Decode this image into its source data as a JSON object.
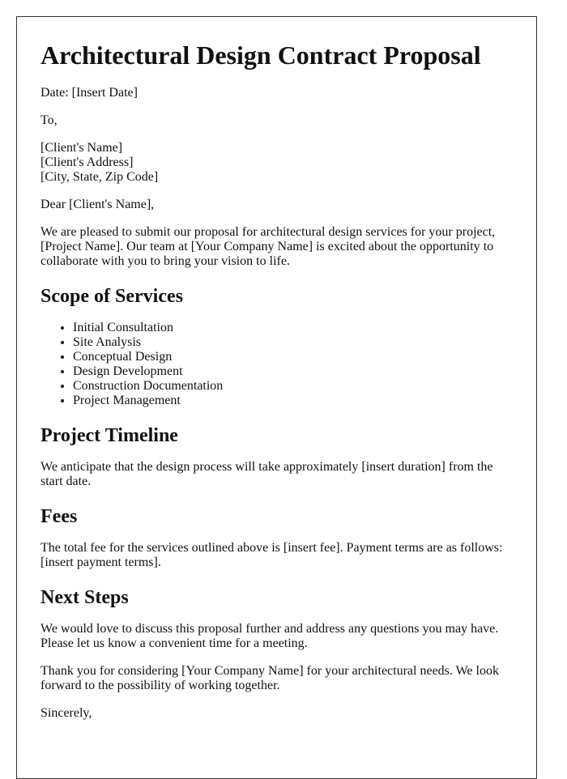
{
  "document": {
    "title": "Architectural Design Contract Proposal",
    "date_line": "Date: [Insert Date]",
    "to_line": "To,",
    "recipient": {
      "name": "[Client's Name]",
      "address": "[Client's Address]",
      "city_state_zip": "[City, State, Zip Code]"
    },
    "salutation": "Dear [Client's Name],",
    "intro": "We are pleased to submit our proposal for architectural design services for your project, [Project Name]. Our team at [Your Company Name] is excited about the opportunity to collaborate with you to bring your vision to life.",
    "sections": {
      "scope": {
        "heading": "Scope of Services",
        "items": [
          "Initial Consultation",
          "Site Analysis",
          "Conceptual Design",
          "Design Development",
          "Construction Documentation",
          "Project Management"
        ]
      },
      "timeline": {
        "heading": "Project Timeline",
        "body": "We anticipate that the design process will take approximately [insert duration] from the start date."
      },
      "fees": {
        "heading": "Fees",
        "body": "The total fee for the services outlined above is [insert fee]. Payment terms are as follows: [insert payment terms]."
      },
      "next_steps": {
        "heading": "Next Steps",
        "body": "We would love to discuss this proposal further and address any questions you may have. Please let us know a convenient time for a meeting."
      }
    },
    "closing_paragraph": "Thank you for considering [Your Company Name] for your architectural needs. We look forward to the possibility of working together.",
    "sign_off": "Sincerely,"
  }
}
